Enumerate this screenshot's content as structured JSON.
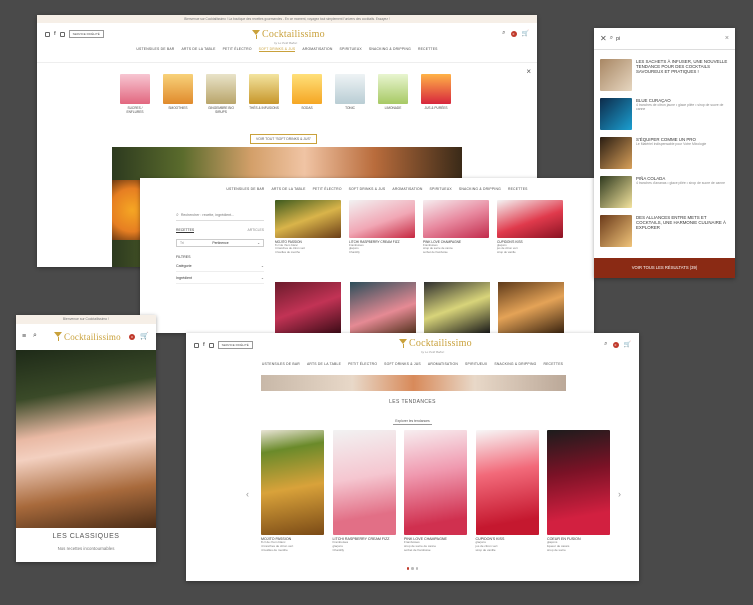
{
  "w1": {
    "banner": "Bienvenue sur Cocktailissimo ! La boutique des recettes gourmandes - En ce moment, voyagez tout simplement l'univers des cocktails. Essayez !",
    "service": "SERVICE FIDÉLITÉ",
    "badge": "0",
    "nav": [
      "USTENSILES DE BAR",
      "ARTS DE LA TABLE",
      "PETIT ÉLECTRO",
      "SOFT DRINKS & JUS",
      "AROMATISATION",
      "SPIRITUEUX",
      "SNACKING & DRIPPING",
      "RECETTES"
    ],
    "nav_active": 3,
    "cats": [
      "SUCRES / ENFLURES",
      "SMOOTHIES",
      "GINGEMBRE BIO SIRUPS",
      "THÉS & INFUSIONS",
      "SODAS",
      "TONIC",
      "LIMONADE",
      "JUS & PURÉES"
    ],
    "cta": "VOIR TOUT \"SOFT DRINKS & JUS\"",
    "close": "×"
  },
  "w2": {
    "nav": [
      "USTENSILES DE BAR",
      "ARTS DE LA TABLE",
      "PETIT ÉLECTRO",
      "SOFT DRINKS & JUS",
      "AROMATISATION",
      "SPIRITUEUX",
      "SNACKING & DRIPPING",
      "RECETTES"
    ],
    "search_placeholder": "Rechercher : recette, ingrédient...",
    "tab_left": "RECETTES",
    "tab_right": "ARTICLES",
    "sort_prefix": "Tri",
    "sort_value": "Pertinence",
    "filters_title": "FILTRES",
    "filter1": "Catégorie",
    "filter2": "Ingrédient",
    "cards": [
      {
        "t": "MOJITO PASSION",
        "d": [
          "8 cl de rhum blanc",
          "4 tranches de citron vert",
          "4 feuilles de menthe"
        ]
      },
      {
        "t": "LITCHI RASPBERRY CREAM FIZZ",
        "d": [
          "Framboises",
          "glaçons",
          "Chantilly"
        ]
      },
      {
        "t": "PINK LOVE CHAMPAGNE",
        "d": [
          "Framboises",
          "sirop de sucre de canne",
          "sorbet de framboise"
        ]
      },
      {
        "t": "CUPIDON'S KISS",
        "d": [
          "glaçons",
          "jus de citron vert",
          "sirop de vanille"
        ]
      }
    ]
  },
  "w3": {
    "query": "pi",
    "close": "×",
    "items": [
      {
        "t": "LES SACHETS À INFUSER, UNE NOUVELLE TENDANCE POUR DES COCKTAILS SAVOUREUX ET PRATIQUES !",
        "d": ""
      },
      {
        "t": "BLUE CURAÇAO",
        "d": "4 tranches de citron jaune • glace pilée • sirop de sucre de canne"
      },
      {
        "t": "S'ÉQUIPER COMME UN PRO",
        "d": "Le Matériel indispensable pour Votre Mixologie"
      },
      {
        "t": "PIÑA COLADA",
        "d": "4 tranches d'ananas • glace pilée • sirop de sucre de canne"
      },
      {
        "t": "DES ALLIANCES ENTRE METS ET COCKTAILS, UNE HARMONIE CULINAIRE À EXPLORER",
        "d": ""
      }
    ],
    "cta": "VOIR TOUS LES RÉSULTATS (39)"
  },
  "w4": {
    "banner": "Bienvenue sur Cocktailissimo !",
    "badge": "0",
    "title": "LES CLASSIQUES",
    "subtitle": "Nos recettes incontournables"
  },
  "w5": {
    "service": "SERVICE FIDÉLITÉ",
    "badge": "0",
    "nav": [
      "USTENSILES DE BAR",
      "ARTS DE LA TABLE",
      "PETIT ÉLECTRO",
      "SOFT DRINKS & JUS",
      "AROMATISATION",
      "SPIRITUEUX",
      "SNACKING & DRIPPING",
      "RECETTES"
    ],
    "section_title": "LES TENDANCES",
    "section_btn": "Explorer les tendances",
    "cards": [
      {
        "t": "MOJITO PASSION",
        "d": [
          "8 cl de rhum blanc",
          "4 tranches de citron vert",
          "4 feuilles de menthe"
        ]
      },
      {
        "t": "LITCHI RASPBERRY CREAM FIZZ",
        "d": [
          "Framboises",
          "glaçons",
          "Chantilly"
        ]
      },
      {
        "t": "PINK LOVE CHAMPAGNE",
        "d": [
          "Framboises",
          "sirop de sucre de canne",
          "sorbet de framboise"
        ]
      },
      {
        "t": "CUPIDON'S KISS",
        "d": [
          "glaçons",
          "jus de citron vert",
          "sirop de vanille"
        ]
      },
      {
        "t": "COEUR EN FUSION",
        "d": [
          "glaçons",
          "liqueur de cassis",
          "sirop de sucre"
        ]
      }
    ],
    "prev": "‹",
    "next": "›"
  },
  "logo": {
    "word": "Cocktailissimo",
    "sub": "by Le Petit Ballon"
  },
  "colors": {
    "gold": "#c9a13b",
    "cta": "#8a2a14",
    "badge": "#c0392b"
  }
}
